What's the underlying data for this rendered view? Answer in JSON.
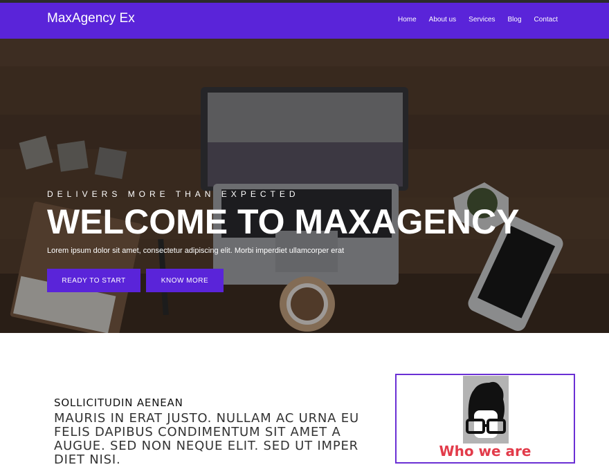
{
  "brand": "MaxAgency Ex",
  "nav": [
    "Home",
    "About us",
    "Services",
    "Blog",
    "Contact"
  ],
  "hero": {
    "tagline": "DELIVERS MORE THAN EXPECTED",
    "headline": "WELCOME TO MAXAGENCY",
    "lead": "Lorem ipsum dolor sit amet, consectetur adipiscing elit. Morbi imperdiet ullamcorper erat",
    "primary_button": "READY TO START",
    "secondary_button": "KNOW MORE"
  },
  "about": {
    "kicker": "SOLLICITUDIN AENEAN",
    "body": "MAURIS IN ERAT JUSTO. NULLAM AC URNA EU FELIS DAPIBUS CONDIMENTUM SIT AMET A AUGUE. SED NON NEQUE ELIT. SED UT IMPER DIET NISI."
  },
  "card": {
    "title": "Who we are"
  },
  "colors": {
    "brand": "#5a24d9",
    "card_border": "#6a2fd4",
    "card_title": "#e23b4a"
  }
}
